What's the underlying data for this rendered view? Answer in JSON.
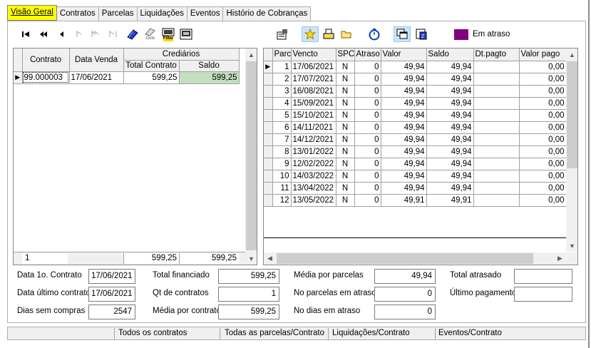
{
  "tabs": [
    {
      "label": "Visão Geral",
      "active": true
    },
    {
      "label": "Contratos"
    },
    {
      "label": "Parcelas"
    },
    {
      "label": "Liquidações"
    },
    {
      "label": "Eventos"
    },
    {
      "label": "Histório de Cobranças"
    }
  ],
  "toolbar": {
    "goto_label": "Goto",
    "filter_label": "Filter"
  },
  "legend": {
    "color": "#800080",
    "label": "Em atraso"
  },
  "contracts": {
    "headers": {
      "contrato": "Contrato",
      "data_venda": "Data Venda",
      "crediarios": "Crediários",
      "total_contrato": "Total Contrato",
      "saldo": "Saldo"
    },
    "rows": [
      {
        "contrato": "99.000003",
        "data_venda": "17/06/2021",
        "total": "599,25",
        "saldo": "599,25"
      }
    ],
    "footer": {
      "count": "1",
      "total": "599,25",
      "saldo": "599,25"
    }
  },
  "parcelas": {
    "headers": {
      "parc": "Parc",
      "vencto": "Vencto",
      "spc": "SPC",
      "atraso": "Atraso",
      "valor": "Valor",
      "saldo": "Saldo",
      "dt_pagto": "Dt.pagto",
      "valor_pago": "Valor pago"
    },
    "rows": [
      {
        "parc": "1",
        "vencto": "17/06/2021",
        "spc": "N",
        "atraso": "0",
        "valor": "49,94",
        "saldo": "49,94",
        "dt_pagto": "",
        "valor_pago": "0,00"
      },
      {
        "parc": "2",
        "vencto": "17/07/2021",
        "spc": "N",
        "atraso": "0",
        "valor": "49,94",
        "saldo": "49,94",
        "dt_pagto": "",
        "valor_pago": "0,00"
      },
      {
        "parc": "3",
        "vencto": "16/08/2021",
        "spc": "N",
        "atraso": "0",
        "valor": "49,94",
        "saldo": "49,94",
        "dt_pagto": "",
        "valor_pago": "0,00"
      },
      {
        "parc": "4",
        "vencto": "15/09/2021",
        "spc": "N",
        "atraso": "0",
        "valor": "49,94",
        "saldo": "49,94",
        "dt_pagto": "",
        "valor_pago": "0,00"
      },
      {
        "parc": "5",
        "vencto": "15/10/2021",
        "spc": "N",
        "atraso": "0",
        "valor": "49,94",
        "saldo": "49,94",
        "dt_pagto": "",
        "valor_pago": "0,00"
      },
      {
        "parc": "6",
        "vencto": "14/11/2021",
        "spc": "N",
        "atraso": "0",
        "valor": "49,94",
        "saldo": "49,94",
        "dt_pagto": "",
        "valor_pago": "0,00"
      },
      {
        "parc": "7",
        "vencto": "14/12/2021",
        "spc": "N",
        "atraso": "0",
        "valor": "49,94",
        "saldo": "49,94",
        "dt_pagto": "",
        "valor_pago": "0,00"
      },
      {
        "parc": "8",
        "vencto": "13/01/2022",
        "spc": "N",
        "atraso": "0",
        "valor": "49,94",
        "saldo": "49,94",
        "dt_pagto": "",
        "valor_pago": "0,00"
      },
      {
        "parc": "9",
        "vencto": "12/02/2022",
        "spc": "N",
        "atraso": "0",
        "valor": "49,94",
        "saldo": "49,94",
        "dt_pagto": "",
        "valor_pago": "0,00"
      },
      {
        "parc": "10",
        "vencto": "14/03/2022",
        "spc": "N",
        "atraso": "0",
        "valor": "49,94",
        "saldo": "49,94",
        "dt_pagto": "",
        "valor_pago": "0,00"
      },
      {
        "parc": "11",
        "vencto": "13/04/2022",
        "spc": "N",
        "atraso": "0",
        "valor": "49,94",
        "saldo": "49,94",
        "dt_pagto": "",
        "valor_pago": "0,00"
      },
      {
        "parc": "12",
        "vencto": "13/05/2022",
        "spc": "N",
        "atraso": "0",
        "valor": "49,91",
        "saldo": "49,91",
        "dt_pagto": "",
        "valor_pago": "0,00"
      }
    ]
  },
  "summary": {
    "data_1o_contrato_label": "Data 1o. Contrato",
    "data_1o_contrato": "17/06/2021",
    "data_ultimo_contrato_label": "Data último contrato",
    "data_ultimo_contrato": "17/06/2021",
    "dias_sem_compras_label": "Dias sem compras",
    "dias_sem_compras": "2547",
    "total_financiado_label": "Total financiado",
    "total_financiado": "599,25",
    "qt_contratos_label": "Qt de contratos",
    "qt_contratos": "1",
    "media_contrato_label": "Média por contrato",
    "media_contrato": "599,25",
    "media_parcelas_label": "Média por parcelas",
    "media_parcelas": "49,94",
    "no_parcelas_atraso_label": "No parcelas em atraso",
    "no_parcelas_atraso": "0",
    "no_dias_atraso_label": "No dias em atraso",
    "no_dias_atraso": "0",
    "total_atrasado_label": "Total atrasado",
    "total_atrasado": "",
    "ultimo_pagamento_label": "Último pagamento",
    "ultimo_pagamento": ""
  },
  "status": {
    "todos_contratos": "Todos os contratos",
    "todas_parcelas": "Todas as parcelas/Contrato",
    "liquidacoes": "Liquidações/Contrato",
    "eventos": "Eventos/Contrato"
  }
}
